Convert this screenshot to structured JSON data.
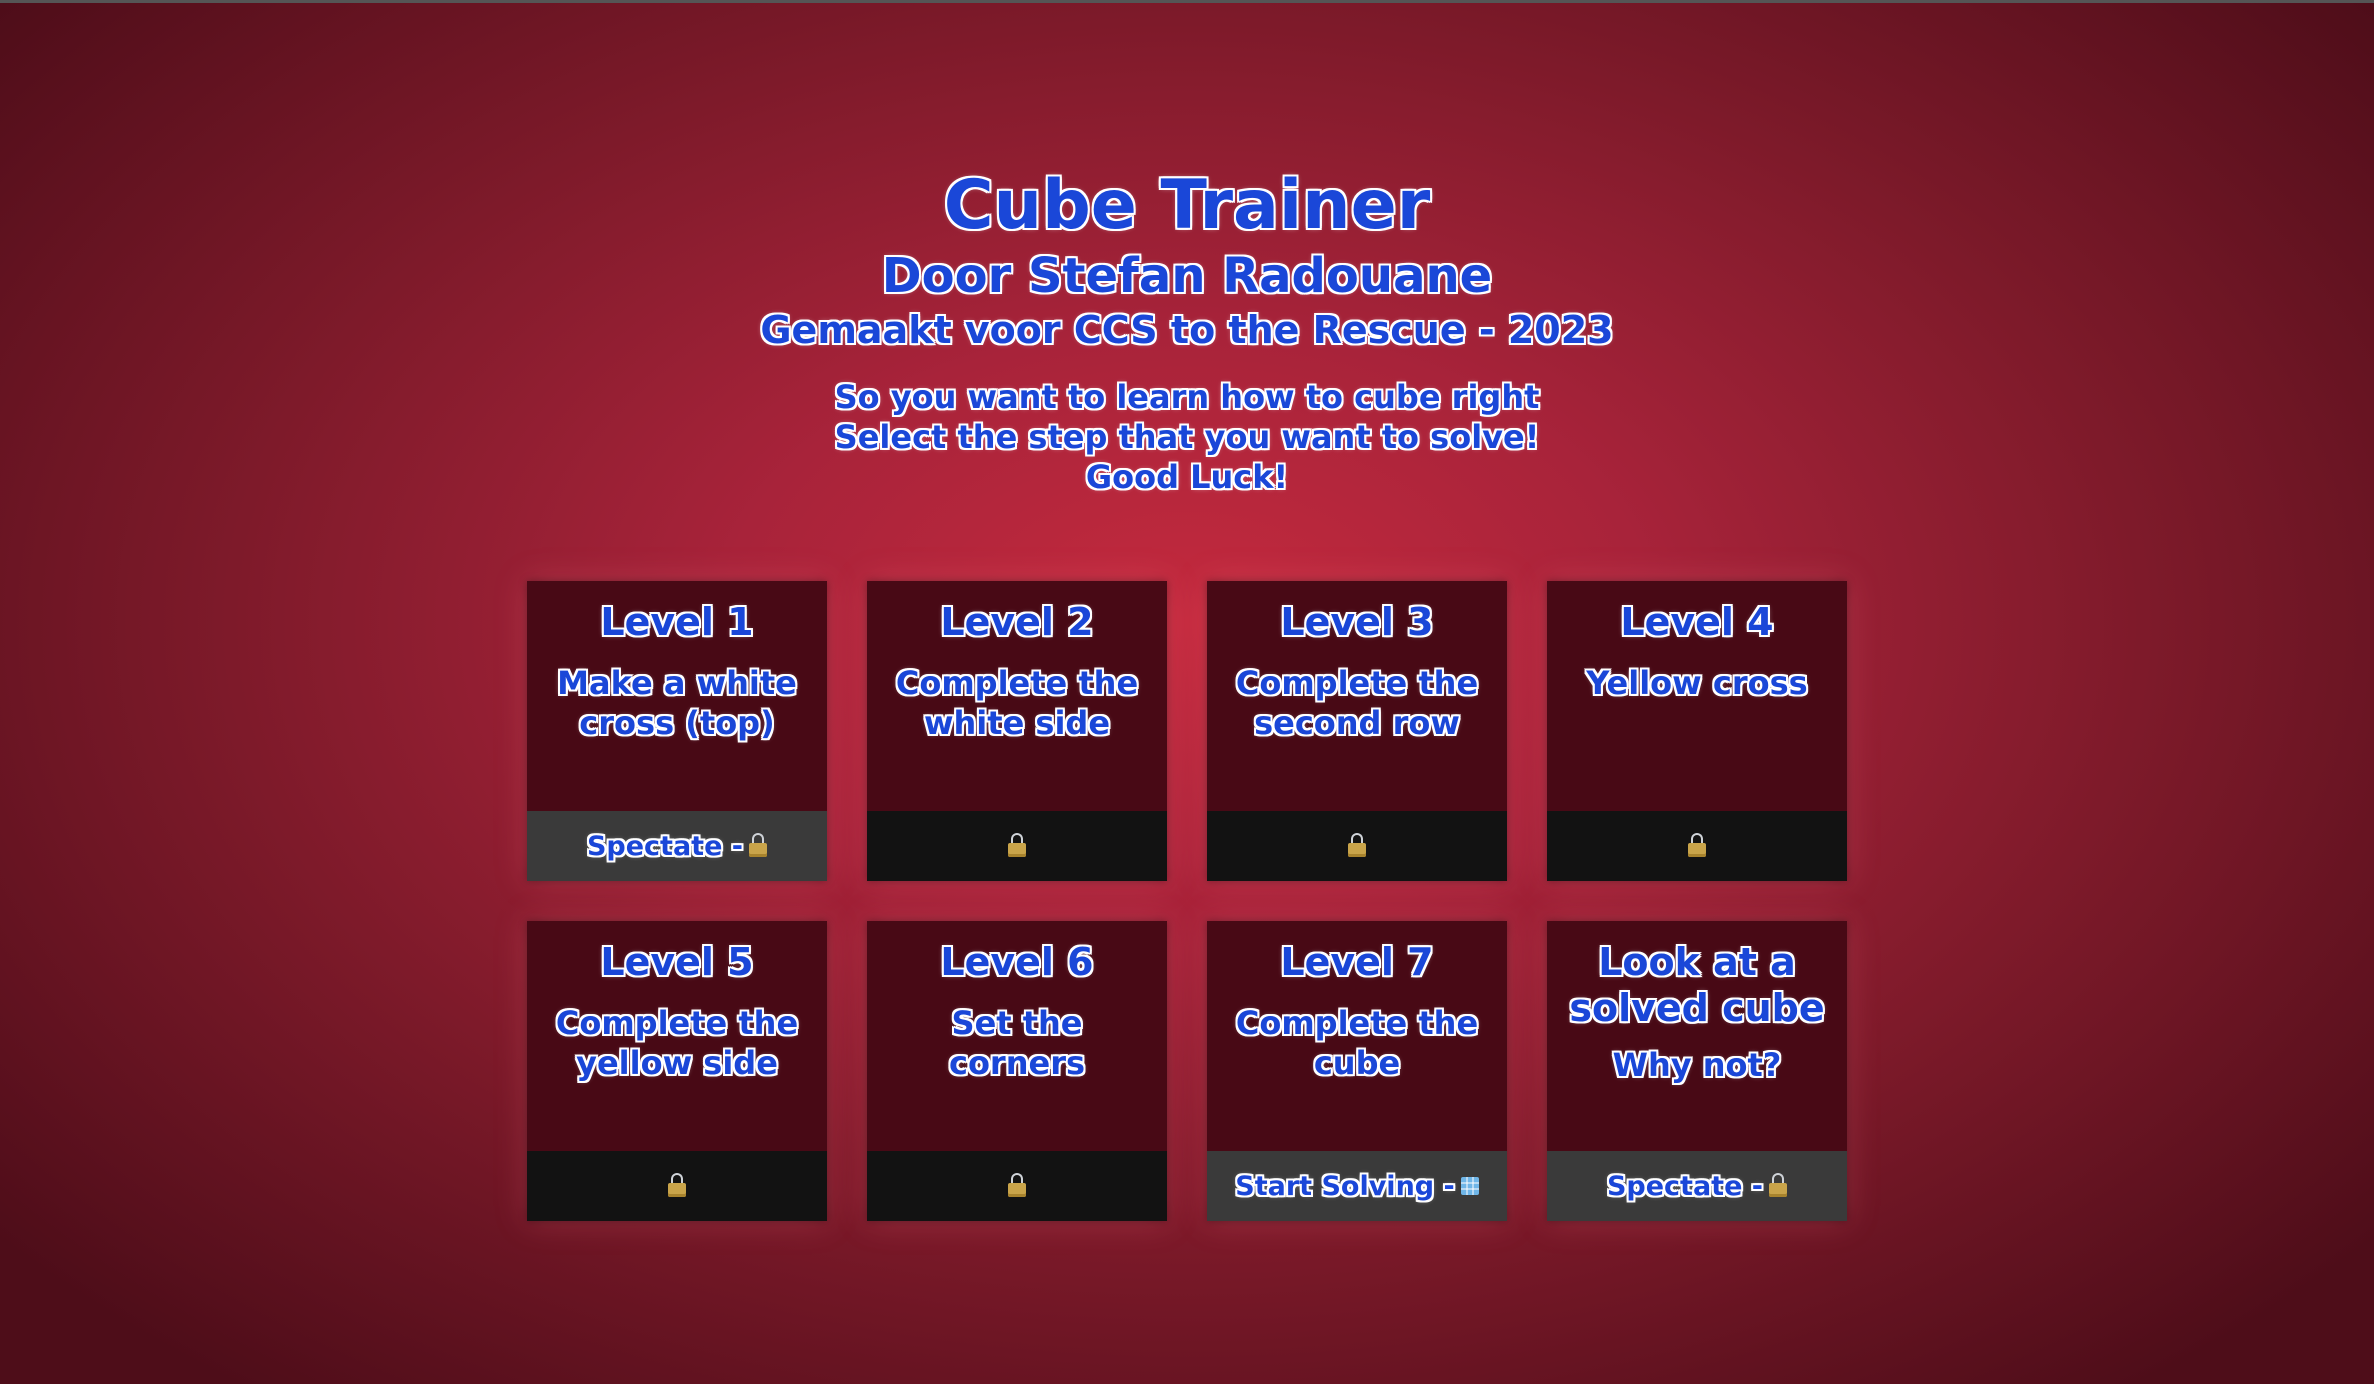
{
  "header": {
    "title": "Cube Trainer",
    "author": "Door Stefan Radouane",
    "made_for": "Gemaakt voor CCS to the Rescue - 2023",
    "intro": [
      "So you want to learn how to cube right",
      "Select the step that you want to solve!",
      "Good Luck!"
    ]
  },
  "levels": [
    {
      "title": "Level 1",
      "description": "Make a white cross (top)",
      "footer_label": "Spectate -",
      "icon": "lock-icon",
      "state": "active"
    },
    {
      "title": "Level 2",
      "description": "Complete the white side",
      "footer_label": "",
      "icon": "lock-icon",
      "state": "locked"
    },
    {
      "title": "Level 3",
      "description": "Complete the second row",
      "footer_label": "",
      "icon": "lock-icon",
      "state": "locked"
    },
    {
      "title": "Level 4",
      "description": "Yellow cross",
      "footer_label": "",
      "icon": "lock-icon",
      "state": "locked"
    },
    {
      "title": "Level 5",
      "description": "Complete the yellow side",
      "footer_label": "",
      "icon": "lock-icon",
      "state": "locked"
    },
    {
      "title": "Level 6",
      "description": "Set the corners",
      "footer_label": "",
      "icon": "lock-icon",
      "state": "locked"
    },
    {
      "title": "Level 7",
      "description": "Complete the cube",
      "footer_label": "Start Solving -",
      "icon": "cube-icon",
      "state": "active"
    },
    {
      "title": "Look at a solved cube",
      "description": "Why not?",
      "footer_label": "Spectate -",
      "icon": "lock-icon",
      "state": "active"
    }
  ],
  "colors": {
    "text": "#1a47d8",
    "text_outline": "#ffffff",
    "card_bg": "#480915",
    "footer_locked": "#121212",
    "footer_active": "#3a3a3a",
    "bg_center": "#c42a3e",
    "bg_edge": "#4e0d19"
  }
}
